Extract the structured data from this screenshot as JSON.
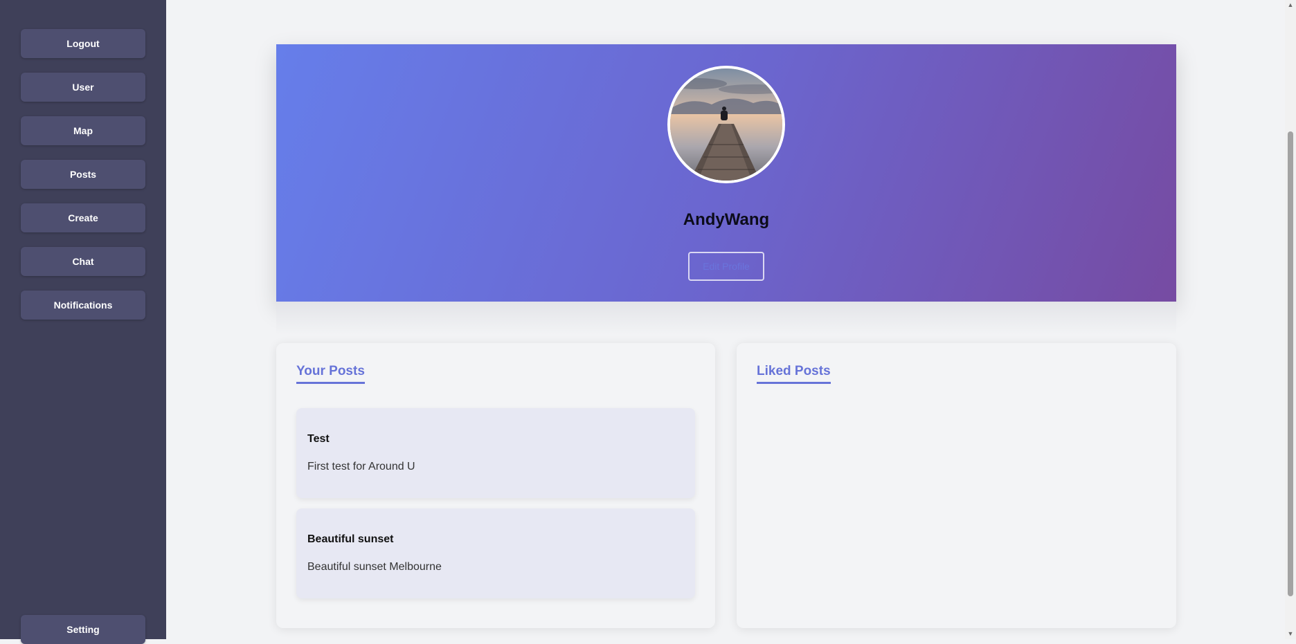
{
  "sidebar": {
    "items": [
      {
        "label": "Logout"
      },
      {
        "label": "User"
      },
      {
        "label": "Map"
      },
      {
        "label": "Posts"
      },
      {
        "label": "Create"
      },
      {
        "label": "Chat"
      },
      {
        "label": "Notifications"
      }
    ],
    "setting_label": "Setting"
  },
  "profile": {
    "username": "AndyWang",
    "edit_label": "Edit Profile",
    "avatar_icon": "landscape-photo-icon"
  },
  "your_posts": {
    "title": "Your Posts",
    "posts": [
      {
        "title": "Test",
        "body": "First test for Around U"
      },
      {
        "title": "Beautiful sunset",
        "body": "Beautiful sunset Melbourne"
      }
    ]
  },
  "liked_posts": {
    "title": "Liked Posts"
  },
  "colors": {
    "sidebar_bg": "#3f4059",
    "nav_btn_bg": "#4e4f70",
    "gradient_start": "#667eea",
    "gradient_end": "#764ba2",
    "accent": "#6673d8"
  }
}
